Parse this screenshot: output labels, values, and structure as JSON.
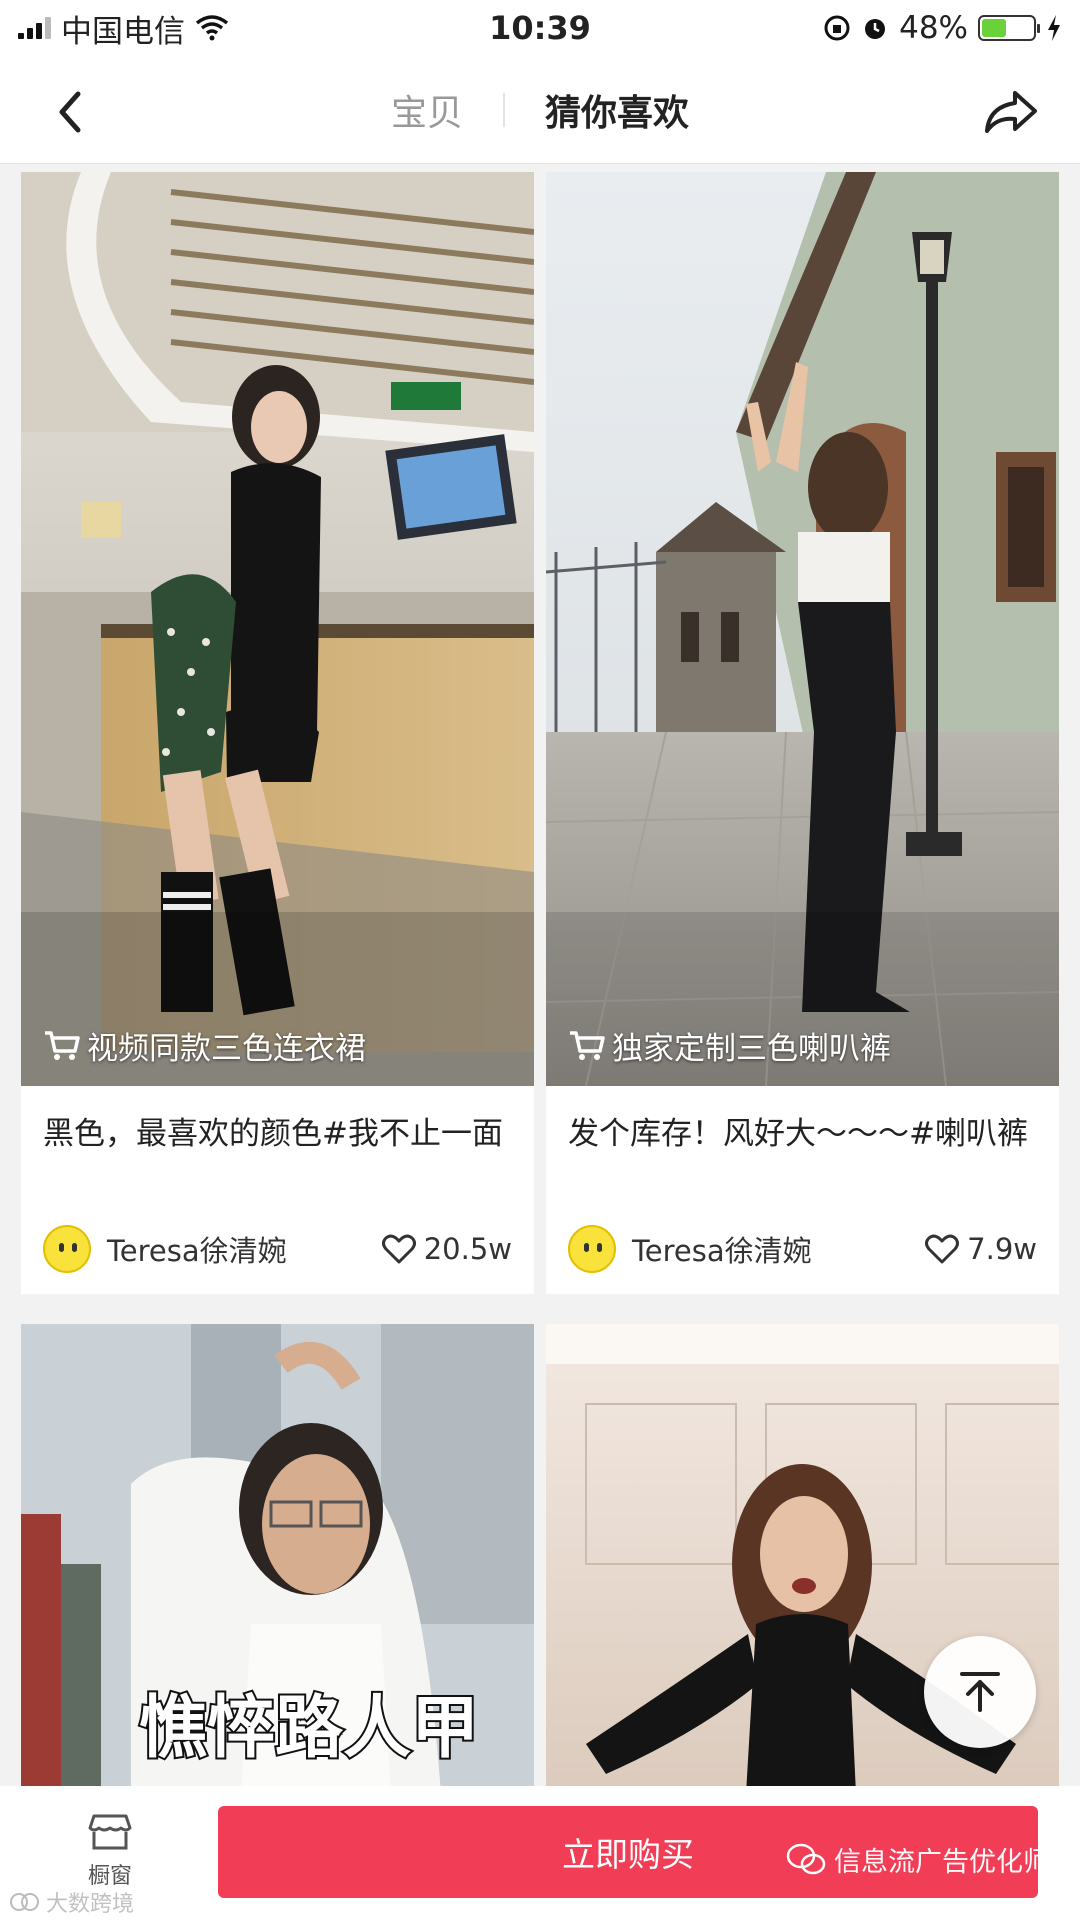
{
  "status_bar": {
    "carrier": "中国电信",
    "time": "10:39",
    "battery_percent": "48%",
    "battery_level": 0.48,
    "icons": [
      "signal-icon",
      "wifi-icon",
      "rotation-lock-icon",
      "alarm-icon",
      "battery-icon",
      "charging-icon"
    ]
  },
  "header": {
    "tab_inactive": "宝贝",
    "tab_active": "猜你喜欢",
    "back_icon": "chevron-left-icon",
    "share_icon": "share-icon"
  },
  "cards": [
    {
      "tag": "视频同款三色连衣裙",
      "title": "黑色，最喜欢的颜色#我不止一面",
      "author": "Teresa徐清婉",
      "likes": "20.5w"
    },
    {
      "tag": "独家定制三色喇叭裤",
      "title": "发个库存！风好大～～～#喇叭裤",
      "author": "Teresa徐清婉",
      "likes": "7.9w"
    },
    {
      "overlay": "憔悴路人甲"
    },
    {}
  ],
  "bottom_bar": {
    "showcase_label": "橱窗",
    "buy_label": "立即购买",
    "watermark_right": "信息流广告优化师",
    "watermark_left": "大数跨境"
  },
  "colors": {
    "buy_button": "#f23d57",
    "battery_fill": "#6bd13a"
  }
}
